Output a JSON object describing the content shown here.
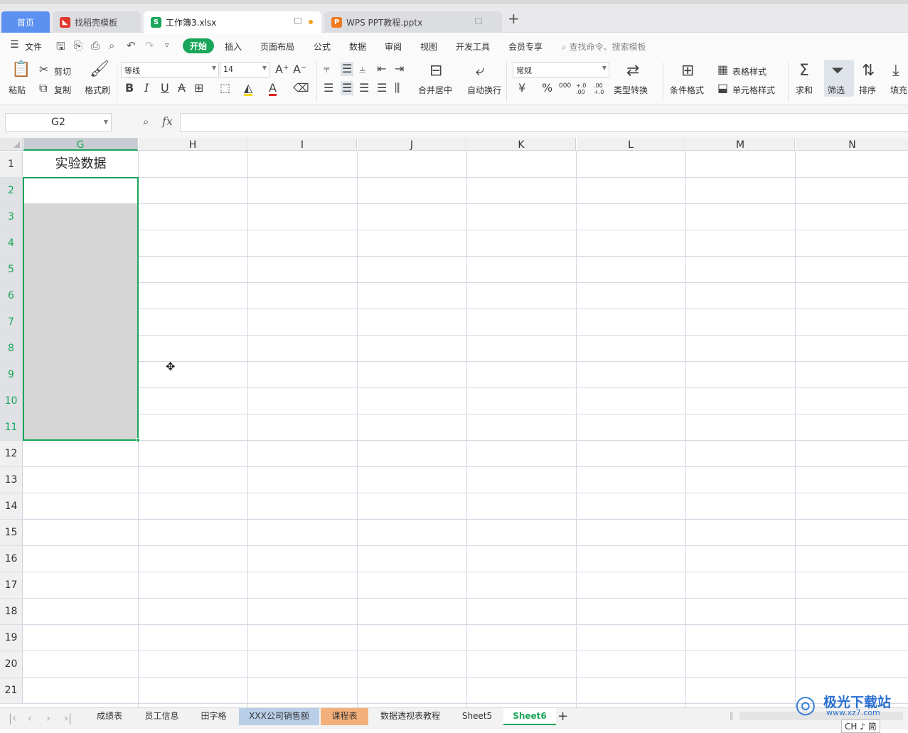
{
  "tabs": {
    "home": "首页",
    "template": "找稻壳模板",
    "workbook": "工作簿3.xlsx",
    "ppt": "WPS PPT教程.pptx"
  },
  "menu": {
    "file": "文件",
    "start": "开始",
    "insert": "插入",
    "page_layout": "页面布局",
    "formula": "公式",
    "data": "数据",
    "review": "审阅",
    "view": "视图",
    "dev_tools": "开发工具",
    "member": "会员专享",
    "search_placeholder": "查找命令、搜索模板"
  },
  "ribbon": {
    "paste": "粘贴",
    "cut": "剪切",
    "copy": "复制",
    "format_painter": "格式刷",
    "font_name": "等线",
    "font_size": "14",
    "merge_center": "合并居中",
    "wrap_text": "自动换行",
    "number_format": "常规",
    "type_convert": "类型转换",
    "conditional_format": "条件格式",
    "table_style": "表格样式",
    "cell_style": "单元格样式",
    "sum": "求和",
    "filter": "筛选",
    "sort": "排序",
    "fill": "填充",
    "bold": "B",
    "italic": "I",
    "underline": "U",
    "currency": "¥",
    "percent": "%",
    "thousands": "000",
    "inc_decimal": "+.0 .00",
    "dec_decimal": ".00 +.0"
  },
  "formula_bar": {
    "name_box": "G2",
    "fx": "fx",
    "content": ""
  },
  "grid": {
    "columns": [
      "G",
      "H",
      "I",
      "J",
      "K",
      "L",
      "M",
      "N"
    ],
    "rows": [
      "1",
      "2",
      "3",
      "4",
      "5",
      "6",
      "7",
      "8",
      "9",
      "10",
      "11",
      "12",
      "13",
      "14",
      "15",
      "16",
      "17",
      "18",
      "19",
      "20",
      "21"
    ],
    "selected_column": "G",
    "selected_rows": [
      "2",
      "3",
      "4",
      "5",
      "6",
      "7",
      "8",
      "9",
      "10",
      "11"
    ],
    "cells": {
      "G1": "实验数据"
    }
  },
  "sheets": {
    "tabs": [
      "成绩表",
      "员工信息",
      "田字格",
      "XXX公司销售额",
      "课程表",
      "数据透视表教程",
      "Sheet5",
      "Sheet6"
    ],
    "active": "Sheet6"
  },
  "watermark": {
    "text": "极光下载站",
    "url": "www.xz7.com"
  },
  "ime": "CH ♪ 简",
  "colors": {
    "accent": "#1aa65a",
    "home_tab": "#5b8ff0",
    "selection": "#d6d6d6"
  }
}
